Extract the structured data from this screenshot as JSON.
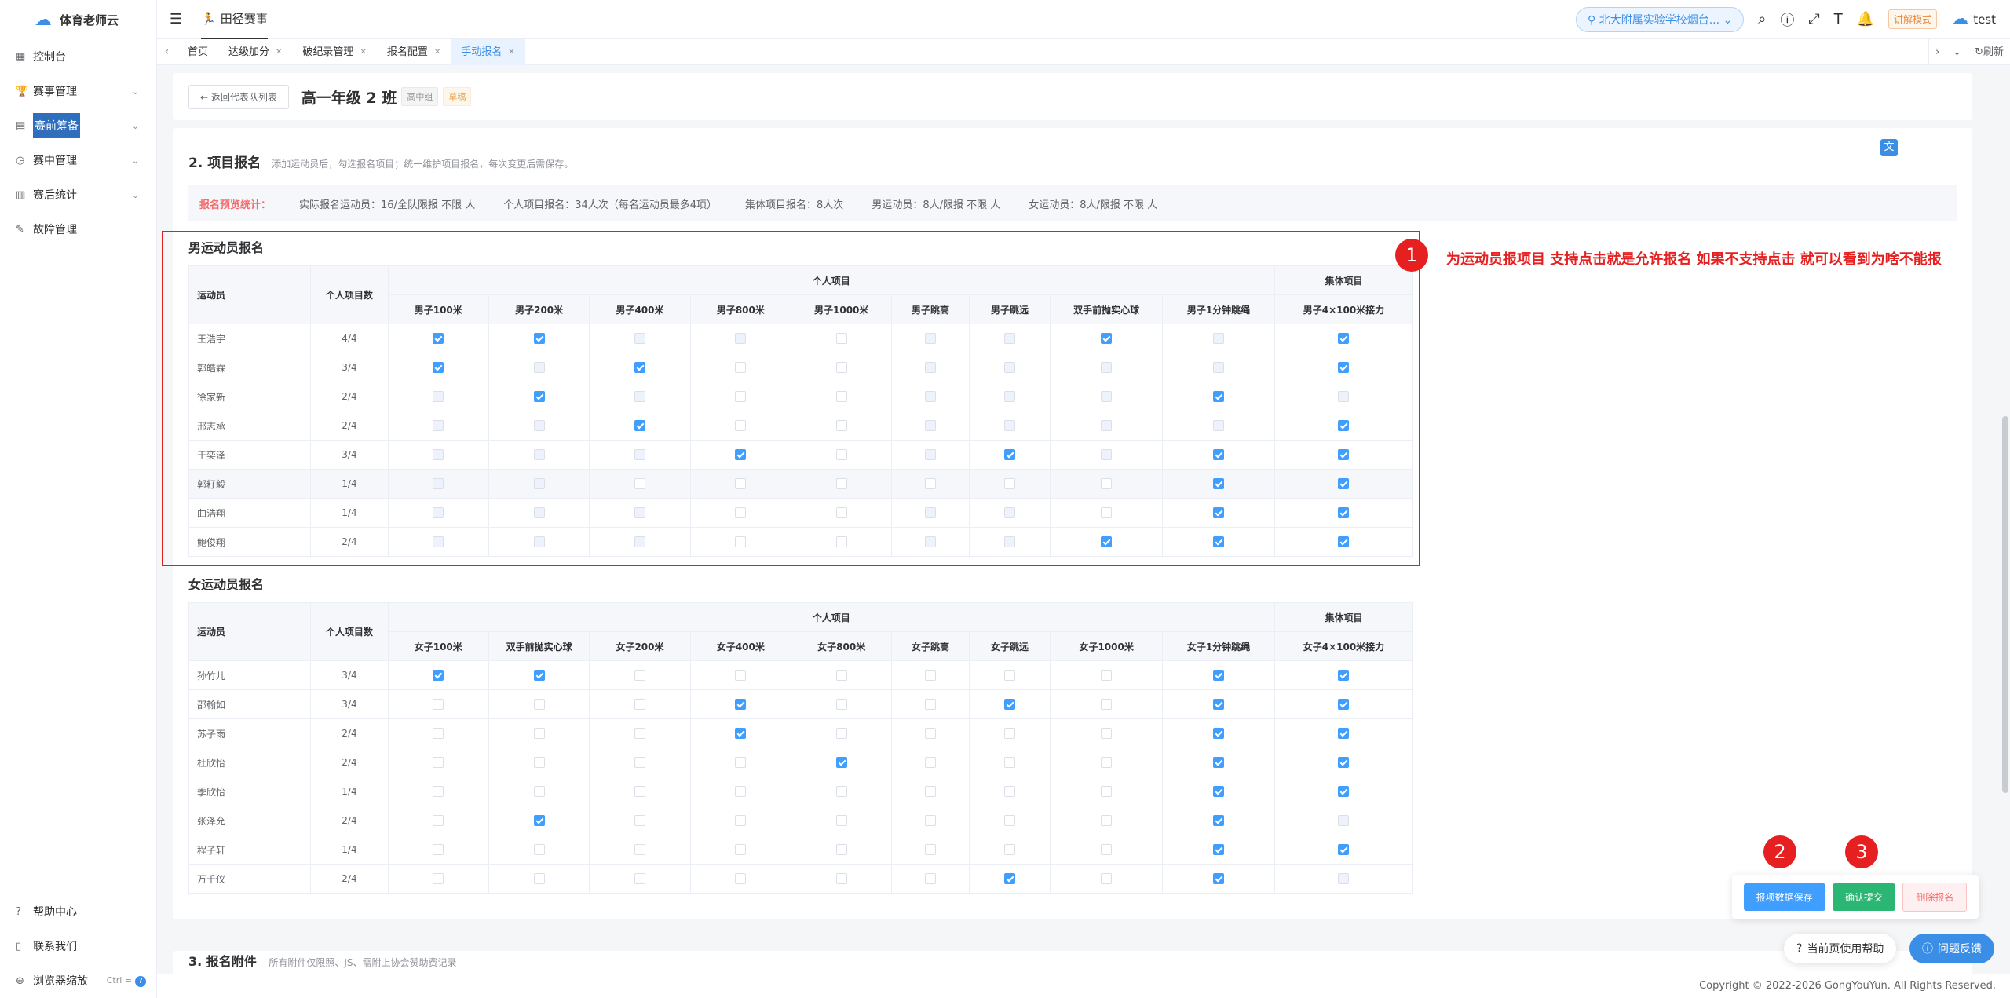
{
  "sidebar": {
    "logo": "体育老师云",
    "items": [
      {
        "label": "控制台",
        "icon": "dashboard-icon",
        "chevron": false
      },
      {
        "label": "赛事管理",
        "icon": "trophy-icon",
        "chevron": true
      },
      {
        "label": "赛前筹备",
        "icon": "document-icon",
        "chevron": true,
        "active": true
      },
      {
        "label": "赛中管理",
        "icon": "stopwatch-icon",
        "chevron": true
      },
      {
        "label": "赛后统计",
        "icon": "chart-icon",
        "chevron": true
      },
      {
        "label": "故障管理",
        "icon": "wrench-icon",
        "chevron": false
      }
    ],
    "bottom": [
      {
        "label": "帮助中心",
        "icon": "help-icon"
      },
      {
        "label": "联系我们",
        "icon": "phone-icon"
      },
      {
        "label": "浏览器缩放",
        "icon": "zoom-icon",
        "kbd": "Ctrl ="
      }
    ]
  },
  "topbar": {
    "breadcrumb": "田径赛事",
    "school": "北大附属实验学校烟台...",
    "mode": "讲解模式",
    "user": "test"
  },
  "tabs": {
    "items": [
      {
        "label": "首页",
        "closable": false,
        "active": false
      },
      {
        "label": "达级加分",
        "closable": true,
        "active": false
      },
      {
        "label": "破纪录管理",
        "closable": true,
        "active": false
      },
      {
        "label": "报名配置",
        "closable": true,
        "active": false
      },
      {
        "label": "手动报名",
        "closable": true,
        "active": true
      }
    ],
    "refresh": "刷新"
  },
  "header": {
    "back": "← 返回代表队列表",
    "class_name": "高一年级 2 班",
    "tag1": "高中组",
    "tag2": "草稿"
  },
  "section": {
    "title": "2. 项目报名",
    "desc": "添加运动员后，勾选报名项目；统一维护项目报名，每次变更后需保存。"
  },
  "stats": {
    "label": "报名预览统计：",
    "items": [
      "实际报名运动员：16/全队限报 不限 人",
      "个人项目报名：34人次（每名运动员最多4项）",
      "集体项目报名：8人次",
      "男运动员：8人/限报 不限 人",
      "女运动员：8人/限报 不限 人"
    ]
  },
  "male": {
    "title": "男运动员报名",
    "col_athlete": "运动员",
    "col_count": "个人项目数",
    "group_individual": "个人项目",
    "group_team": "集体项目",
    "events": [
      "男子100米",
      "男子200米",
      "男子400米",
      "男子800米",
      "男子1000米",
      "男子跳高",
      "男子跳远",
      "双手前抛实心球",
      "男子1分钟跳绳"
    ],
    "team_event": "男子4×100米接力",
    "rows": [
      {
        "name": "王浩宇",
        "count": "4/4",
        "cells": "CCddeddCdC d",
        "hl": false
      },
      {
        "name": "郭皓霖",
        "count": "3/4",
        "cells": "CdCeeddddC d",
        "hl": false
      },
      {
        "name": "徐家新",
        "count": "2/4",
        "cells": "dCdeedddC d",
        "hl": false
      },
      {
        "name": "邢志承",
        "count": "2/4",
        "cells": "ddCeeddddC d",
        "hl": false
      },
      {
        "name": "于奕泽",
        "count": "3/4",
        "cells": "dddCedCdC C",
        "hl": false
      },
      {
        "name": "郭籽毅",
        "count": "1/4",
        "cells": "ddeeeeeeC C",
        "hl": true
      },
      {
        "name": "曲浩翔",
        "count": "1/4",
        "cells": "dddeeddeC C",
        "hl": false
      },
      {
        "name": "鲍俊翔",
        "count": "2/4",
        "cells": "dddeeddCC C",
        "hl": false
      }
    ]
  },
  "female": {
    "title": "女运动员报名",
    "col_athlete": "运动员",
    "col_count": "个人项目数",
    "group_individual": "个人项目",
    "group_team": "集体项目",
    "events": [
      "女子100米",
      "双手前抛实心球",
      "女子200米",
      "女子400米",
      "女子800米",
      "女子跳高",
      "女子跳远",
      "女子1000米",
      "女子1分钟跳绳"
    ],
    "team_event": "女子4×100米接力",
    "rows": [
      {
        "name": "孙竹儿",
        "count": "3/4",
        "cells": "CCeeeeeeC C",
        "hl": false
      },
      {
        "name": "邵翰如",
        "count": "3/4",
        "cells": "eeeCeeCeC C",
        "hl": false
      },
      {
        "name": "苏子雨",
        "count": "2/4",
        "cells": "eeeCeeeeC C",
        "hl": false
      },
      {
        "name": "杜欣怡",
        "count": "2/4",
        "cells": "eeeeCeeeC C",
        "hl": false
      },
      {
        "name": "季欣怡",
        "count": "1/4",
        "cells": "eeeeeeeeC C",
        "hl": false
      },
      {
        "name": "张泽允",
        "count": "2/4",
        "cells": "eCeeeeeeC d",
        "hl": false
      },
      {
        "name": "程子轩",
        "count": "1/4",
        "cells": "eeeeeeeeC C",
        "hl": false
      },
      {
        "name": "万千仪",
        "count": "2/4",
        "cells": "eeeeeeCeC d",
        "hl": false
      }
    ]
  },
  "annotations": {
    "m1": "1",
    "m2": "2",
    "m3": "3",
    "note": "为运动员报项目 支持点击就是允许报名  如果不支持点击 就可以看到为啥不能报"
  },
  "section3": {
    "title": "3. 报名附件",
    "desc": "所有附件仅限照、JS、需附上协会赞助费记录"
  },
  "actions": {
    "save": "报项数据保存",
    "submit": "确认提交",
    "delete": "删除报名"
  },
  "help": {
    "page_help": "当前页使用帮助",
    "feedback": "问题反馈"
  },
  "footer": "Copyright © 2022-2026 GongYouYun. All Rights Reserved."
}
